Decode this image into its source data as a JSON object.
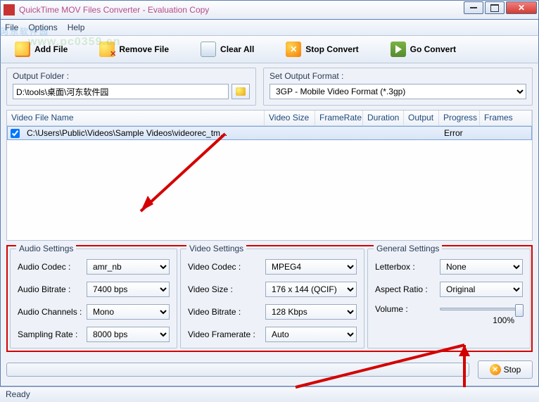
{
  "window": {
    "title": "QuickTime MOV Files Converter - Evaluation Copy"
  },
  "watermark": {
    "line1": "河东软件园",
    "line2": "www.pc0359.cn"
  },
  "menu": {
    "file": "File",
    "options": "Options",
    "help": "Help"
  },
  "toolbar": {
    "add": "Add File",
    "remove": "Remove File",
    "clear": "Clear All",
    "stopconv": "Stop Convert",
    "goconv": "Go Convert"
  },
  "outputFolder": {
    "label": "Output Folder :",
    "value": "D:\\tools\\桌面\\河东软件园"
  },
  "outputFormat": {
    "label": "Set Output Format :",
    "value": "3GP - Mobile Video Format (*.3gp)"
  },
  "columns": {
    "name": "Video File Name",
    "size": "Video Size",
    "framerate": "FrameRate",
    "duration": "Duration",
    "output": "Output",
    "progress": "Progress",
    "frames": "Frames"
  },
  "rows": [
    {
      "name": "C:\\Users\\Public\\Videos\\Sample Videos\\videorec_tm...",
      "progress": "Error"
    }
  ],
  "audio": {
    "title": "Audio Settings",
    "codec_l": "Audio Codec :",
    "codec": "amr_nb",
    "bitrate_l": "Audio Bitrate :",
    "bitrate": "7400 bps",
    "channels_l": "Audio Channels :",
    "channels": "Mono",
    "sampling_l": "Sampling Rate :",
    "sampling": "8000  bps"
  },
  "video": {
    "title": "Video Settings",
    "codec_l": "Video Codec :",
    "codec": "MPEG4",
    "size_l": "Video Size :",
    "size": "176 x 144 (QCIF)",
    "bitrate_l": "Video Bitrate :",
    "bitrate": "128 Kbps",
    "framerate_l": "Video Framerate :",
    "framerate": "Auto"
  },
  "general": {
    "title": "General Settings",
    "letterbox_l": "Letterbox :",
    "letterbox": "None",
    "aspect_l": "Aspect Ratio :",
    "aspect": "Original",
    "volume_l": "Volume :",
    "volume_pct": "100%"
  },
  "stop": "Stop",
  "status": "Ready"
}
